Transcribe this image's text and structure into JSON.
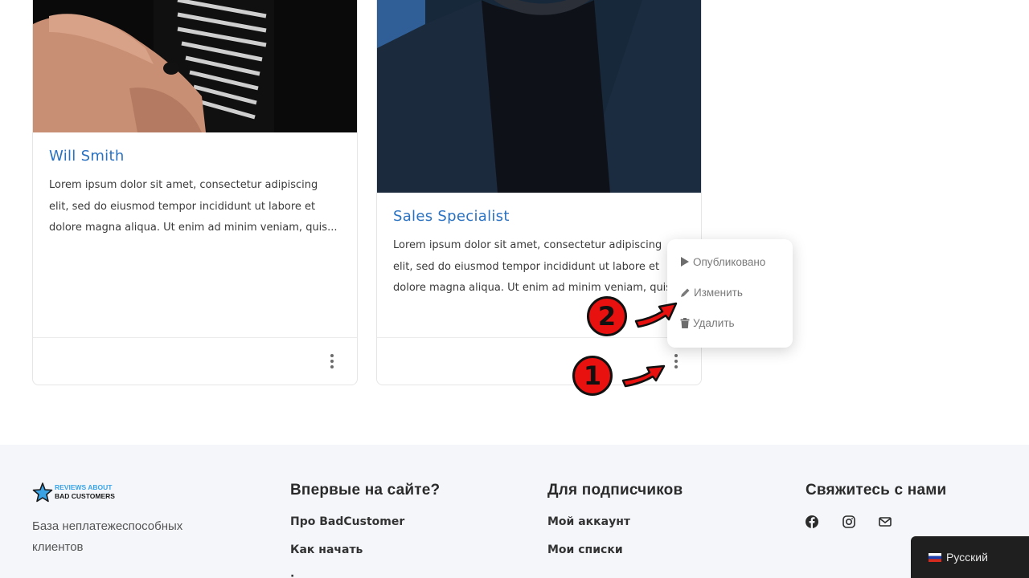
{
  "cards": [
    {
      "title": "Will Smith",
      "text": "Lorem ipsum dolor sit amet, consectetur adipiscing elit, sed do eiusmod tempor incididunt ut labore et dolore magna aliqua. Ut enim ad minim veniam, quis..."
    },
    {
      "title": "Sales Specialist",
      "text": "Lorem ipsum dolor sit amet, consectetur adipiscing elit, sed do eiusmod tempor incididunt ut labore et dolore magna aliqua. Ut enim ad minim veniam, quis..."
    }
  ],
  "context_menu": {
    "items": [
      {
        "label": "Опубликовано",
        "icon": "play-icon"
      },
      {
        "label": "Изменить",
        "icon": "pencil-icon"
      },
      {
        "label": "Удалить",
        "icon": "trash-icon"
      }
    ]
  },
  "annotations": {
    "step1": "1",
    "step2": "2",
    "color": "#e8110f"
  },
  "footer": {
    "logo_line1": "REVIEWS ABOUT",
    "logo_line2": "BAD CUSTOMERS",
    "tagline": "База неплатежеспособных клиентов",
    "columns": [
      {
        "title": "Впервые на сайте?",
        "links": [
          "Про BadCustomer",
          "Как начать"
        ]
      },
      {
        "title": "Для подписчиков",
        "links": [
          "Мой аккаунт",
          "Мои списки"
        ]
      },
      {
        "title": "Свяжитесь с нами",
        "icons": [
          "facebook-icon",
          "instagram-icon",
          "mail-icon"
        ]
      }
    ]
  },
  "language": {
    "label": "Русский",
    "flag": "russia-flag-icon"
  },
  "colors": {
    "link_blue": "#2a72c1",
    "footer_bg": "#f4f6fa",
    "lang_bg": "#1f1f1f"
  }
}
